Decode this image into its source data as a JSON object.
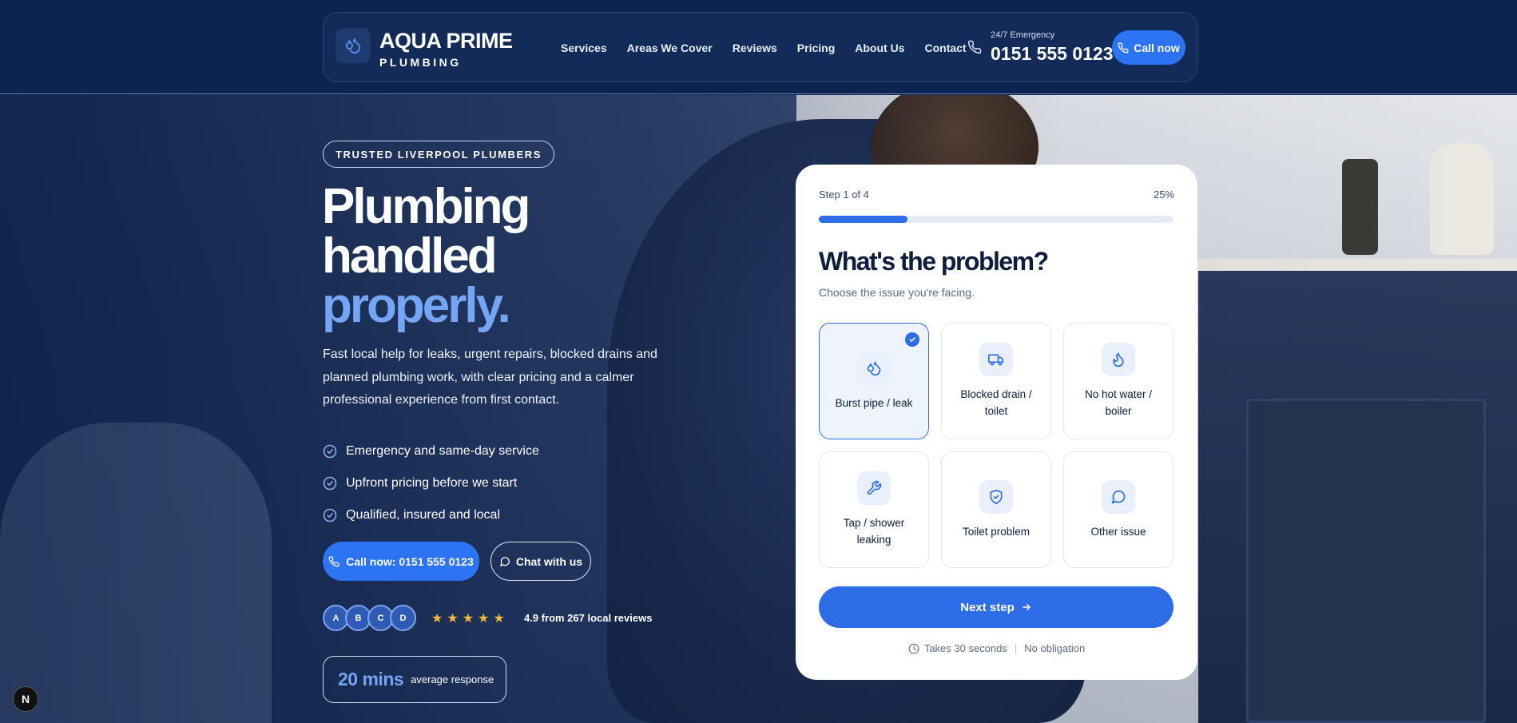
{
  "header": {
    "brand_name": "AQUA PRIME",
    "brand_sub": "PLUMBING",
    "nav": [
      "Services",
      "Areas We Cover",
      "Reviews",
      "Pricing",
      "About Us",
      "Contact"
    ],
    "emergency_label": "24/7 Emergency",
    "emergency_number": "0151 555 0123",
    "call_button": "Call now"
  },
  "hero": {
    "badge": "TRUSTED LIVERPOOL PLUMBERS",
    "title_line1": "Plumbing",
    "title_line2": "handled",
    "title_accent": "properly.",
    "lead": "Fast local help for leaks, urgent repairs, blocked drains and planned plumbing work, with clear pricing and a calmer professional experience from first contact.",
    "checks": [
      "Emergency and same-day service",
      "Upfront pricing before we start",
      "Qualified, insured and local"
    ],
    "primary_button": "Call now: 0151 555 0123",
    "secondary_button": "Chat with us",
    "avatars": [
      "A",
      "B",
      "C",
      "D"
    ],
    "stars": 5,
    "rating_text": "4.9 from 267 local reviews",
    "response_value": "20 mins",
    "response_label": "average response"
  },
  "form_card": {
    "step": "Step 1 of 4",
    "percent_text": "25%",
    "progress": 0.25,
    "question": "What's the problem?",
    "subtitle": "Choose the issue you're facing.",
    "options": [
      {
        "label": "Burst pipe / leak",
        "icon": "droplets-icon",
        "selected": true
      },
      {
        "label": "Blocked drain / toilet",
        "icon": "truck-icon",
        "selected": false
      },
      {
        "label": "No hot water / boiler",
        "icon": "flame-icon",
        "selected": false
      },
      {
        "label": "Tap / shower leaking",
        "icon": "wrench-icon",
        "selected": false
      },
      {
        "label": "Toilet problem",
        "icon": "shield-check-icon",
        "selected": false
      },
      {
        "label": "Other issue",
        "icon": "chat-bubble-icon",
        "selected": false
      }
    ],
    "next_button": "Next step",
    "footer_time": "Takes 30 seconds",
    "footer_note": "No obligation"
  },
  "dev_badge": "N",
  "colors": {
    "accent": "#2d6ee8",
    "accent_light": "#76a5f6",
    "navy": "#0d2350",
    "star": "#f5b83d"
  }
}
